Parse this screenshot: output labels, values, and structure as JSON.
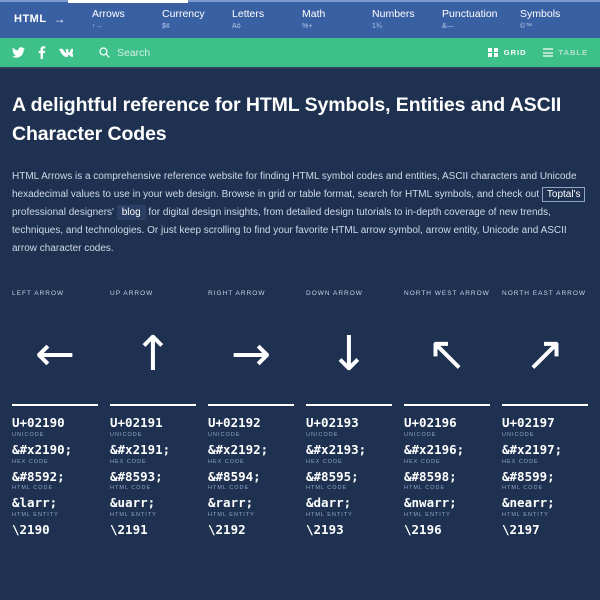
{
  "topnav": {
    "brand_label": "HTML",
    "brand_arrow": "→",
    "items": [
      {
        "label": "Arrows",
        "sub": "↑→"
      },
      {
        "label": "Currency",
        "sub": "$¢"
      },
      {
        "label": "Letters",
        "sub": "Aö"
      },
      {
        "label": "Math",
        "sub": "%+"
      },
      {
        "label": "Numbers",
        "sub": "1¾"
      },
      {
        "label": "Punctuation",
        "sub": "&—"
      },
      {
        "label": "Symbols",
        "sub": "©™"
      }
    ]
  },
  "greenbar": {
    "social": [
      {
        "name": "twitter-icon"
      },
      {
        "name": "facebook-icon"
      },
      {
        "name": "vk-icon"
      }
    ],
    "search": {
      "placeholder": "Search",
      "value": ""
    },
    "views": [
      {
        "label": "GRID",
        "active": true
      },
      {
        "label": "TABLE",
        "active": false
      }
    ]
  },
  "hero": {
    "title": "A delightful reference for HTML Symbols, Entities and ASCII Character Codes",
    "paragraph_part1": "HTML Arrows is a comprehensive reference website for finding HTML symbol codes and entities, ASCII characters and Unicode hexadecimal values to use in your web design. Browse in grid or table format, search for HTML symbols, and check out ",
    "link_toptal": "Toptal's",
    "paragraph_part2": " professional designers' ",
    "link_blog": "blog",
    "paragraph_part3": " for digital design insights, from detailed design tutorials to in-depth coverage of new trends, techniques, and technologies. Or just keep scrolling to find your favorite HTML arrow symbol, arrow entity, Unicode and ASCII arrow character codes."
  },
  "labels": {
    "unicode": "UNICODE",
    "hex_code": "HEX CODE",
    "html_code": "HTML CODE",
    "html_entity": "HTML ENTITY"
  },
  "symbols": [
    {
      "name": "LEFT ARROW",
      "glyph": "←",
      "unicode": "U+02190",
      "hex": "&#x2190;",
      "html": "&#8592;",
      "entity": "&larr;",
      "css": "\\2190"
    },
    {
      "name": "UP ARROW",
      "glyph": "↑",
      "unicode": "U+02191",
      "hex": "&#x2191;",
      "html": "&#8593;",
      "entity": "&uarr;",
      "css": "\\2191"
    },
    {
      "name": "RIGHT ARROW",
      "glyph": "→",
      "unicode": "U+02192",
      "hex": "&#x2192;",
      "html": "&#8594;",
      "entity": "&rarr;",
      "css": "\\2192"
    },
    {
      "name": "DOWN ARROW",
      "glyph": "↓",
      "unicode": "U+02193",
      "hex": "&#x2193;",
      "html": "&#8595;",
      "entity": "&darr;",
      "css": "\\2193"
    },
    {
      "name": "NORTH WEST ARROW",
      "glyph": "↖",
      "unicode": "U+02196",
      "hex": "&#x2196;",
      "html": "&#8598;",
      "entity": "&nwarr;",
      "css": "\\2196"
    },
    {
      "name": "NORTH EAST ARROW",
      "glyph": "↗",
      "unicode": "U+02197",
      "hex": "&#x2197;",
      "html": "&#8599;",
      "entity": "&nearr;",
      "css": "\\2197"
    }
  ],
  "colors": {
    "nav_blue": "#3a60a4",
    "accent_green": "#3ec08b",
    "page_bg": "#1e3150",
    "text_white": "#ffffff",
    "text_muted": "#8fa6c4"
  }
}
